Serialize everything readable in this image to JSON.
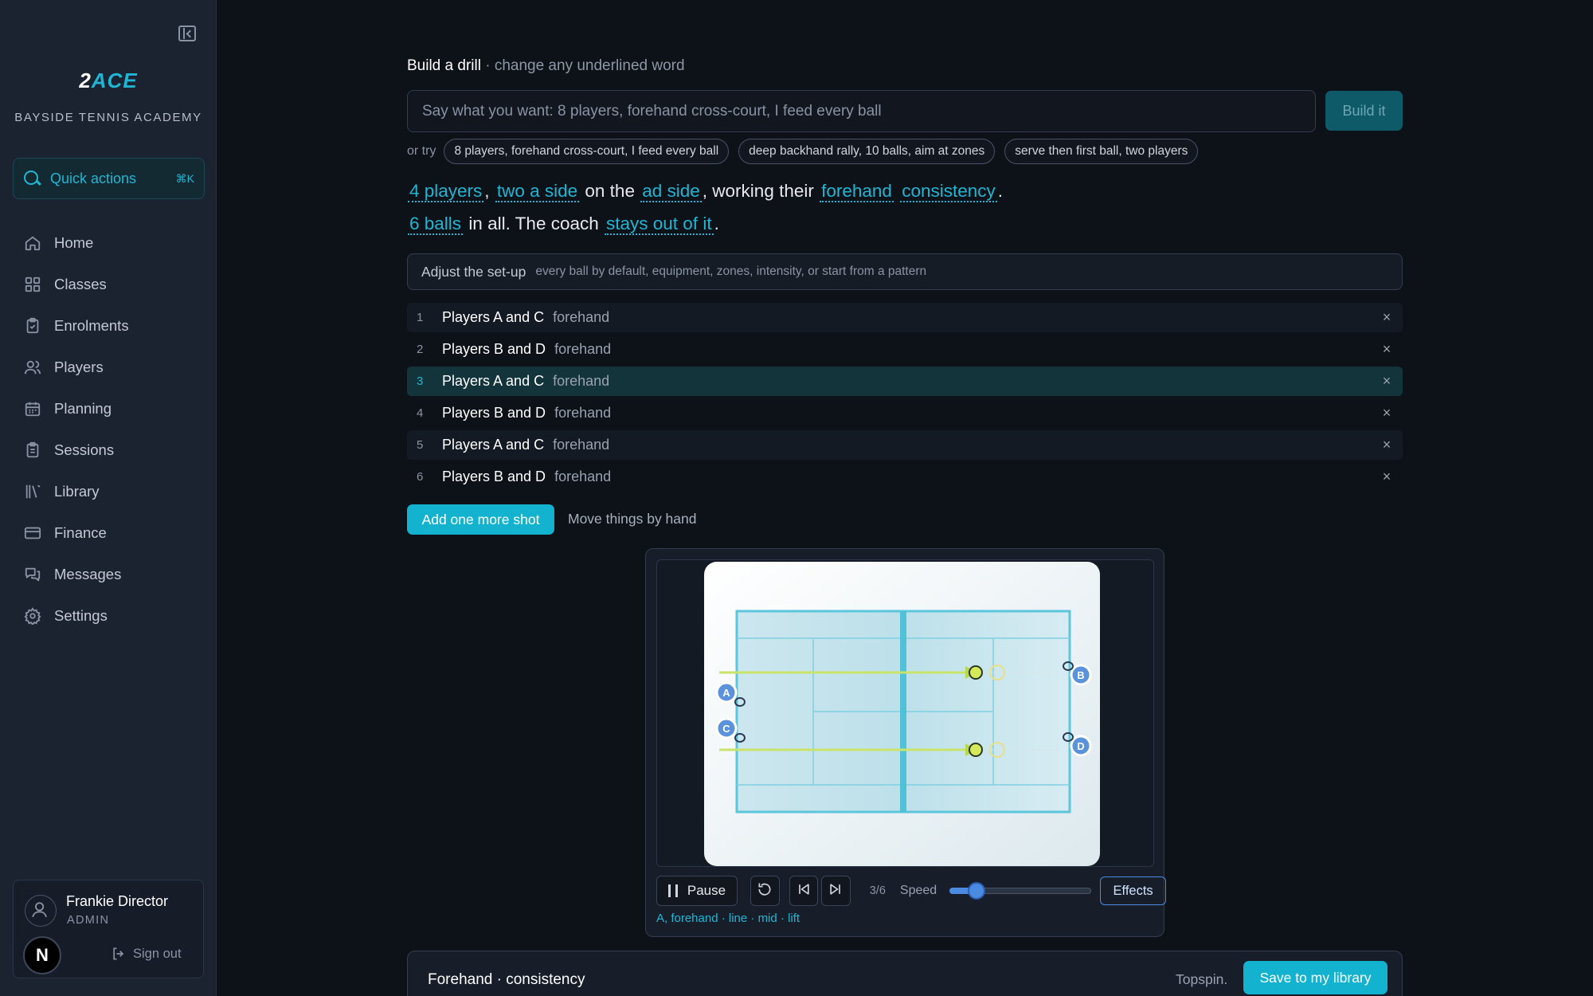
{
  "brand": {
    "logo_a": "2",
    "logo_b": "ACE",
    "academy": "BAYSIDE TENNIS ACADEMY",
    "accent_color": "#1fb6d4"
  },
  "quick_actions": {
    "label": "Quick actions",
    "shortcut": "⌘K"
  },
  "nav": {
    "items": [
      {
        "label": "Home",
        "icon": "home-icon"
      },
      {
        "label": "Classes",
        "icon": "grid-icon"
      },
      {
        "label": "Enrolments",
        "icon": "clipboard-check-icon"
      },
      {
        "label": "Players",
        "icon": "users-icon"
      },
      {
        "label": "Planning",
        "icon": "calendar-icon"
      },
      {
        "label": "Sessions",
        "icon": "clipboard-list-icon"
      },
      {
        "label": "Library",
        "icon": "library-icon"
      },
      {
        "label": "Finance",
        "icon": "credit-card-icon"
      },
      {
        "label": "Messages",
        "icon": "messages-icon"
      },
      {
        "label": "Settings",
        "icon": "gear-icon"
      }
    ]
  },
  "user": {
    "name": "Frankie Director",
    "role": "ADMIN",
    "badge": "N",
    "sign_out": "Sign out"
  },
  "builder": {
    "title": "Build a drill",
    "subtitle": " · change any underlined word",
    "prompt_placeholder": "Say what you want: 8 players, forehand cross-court, I feed every ball",
    "build_label": "Build it",
    "or_try": "or try",
    "suggestions": [
      "8 players, forehand cross-court, I feed every ball",
      "deep backhand rally, 10 balls, aim at zones",
      "serve then first ball, two players"
    ]
  },
  "sentence": {
    "players": "4 players",
    "comma1": ",",
    "sides": "two a side",
    "on_the": "on the",
    "side": "ad side",
    "working": ", working their",
    "stroke": "forehand",
    "focus": "consistency",
    "period1": ".",
    "balls": "6 balls",
    "in_all": "in all. The coach",
    "coach": "stays out of it",
    "period2": "."
  },
  "adjust": {
    "label": "Adjust the set-up",
    "hint": "every ball by default, equipment, zones, intensity, or start from a pattern"
  },
  "shots": [
    {
      "num": "1",
      "players": "Players A and C",
      "stroke": "forehand",
      "remove": "×"
    },
    {
      "num": "2",
      "players": "Players B and D",
      "stroke": "forehand",
      "remove": "×"
    },
    {
      "num": "3",
      "players": "Players A and C",
      "stroke": "forehand",
      "remove": "×"
    },
    {
      "num": "4",
      "players": "Players B and D",
      "stroke": "forehand",
      "remove": "×"
    },
    {
      "num": "5",
      "players": "Players A and C",
      "stroke": "forehand",
      "remove": "×"
    },
    {
      "num": "6",
      "players": "Players B and D",
      "stroke": "forehand",
      "remove": "×"
    }
  ],
  "active_shot": 3,
  "actions": {
    "add_shot": "Add one more shot",
    "move_by_hand": "Move things by hand"
  },
  "player_markers": [
    "A",
    "C",
    "B",
    "D"
  ],
  "playback": {
    "pause": "Pause",
    "counter": "3/6",
    "speed_label": "Speed",
    "speed_value": 0.2,
    "effects": "Effects",
    "caption": "A, forehand · line · mid · lift"
  },
  "summary": {
    "title": "Forehand · consistency",
    "spin": "Topspin.",
    "save": "Save to my library"
  }
}
